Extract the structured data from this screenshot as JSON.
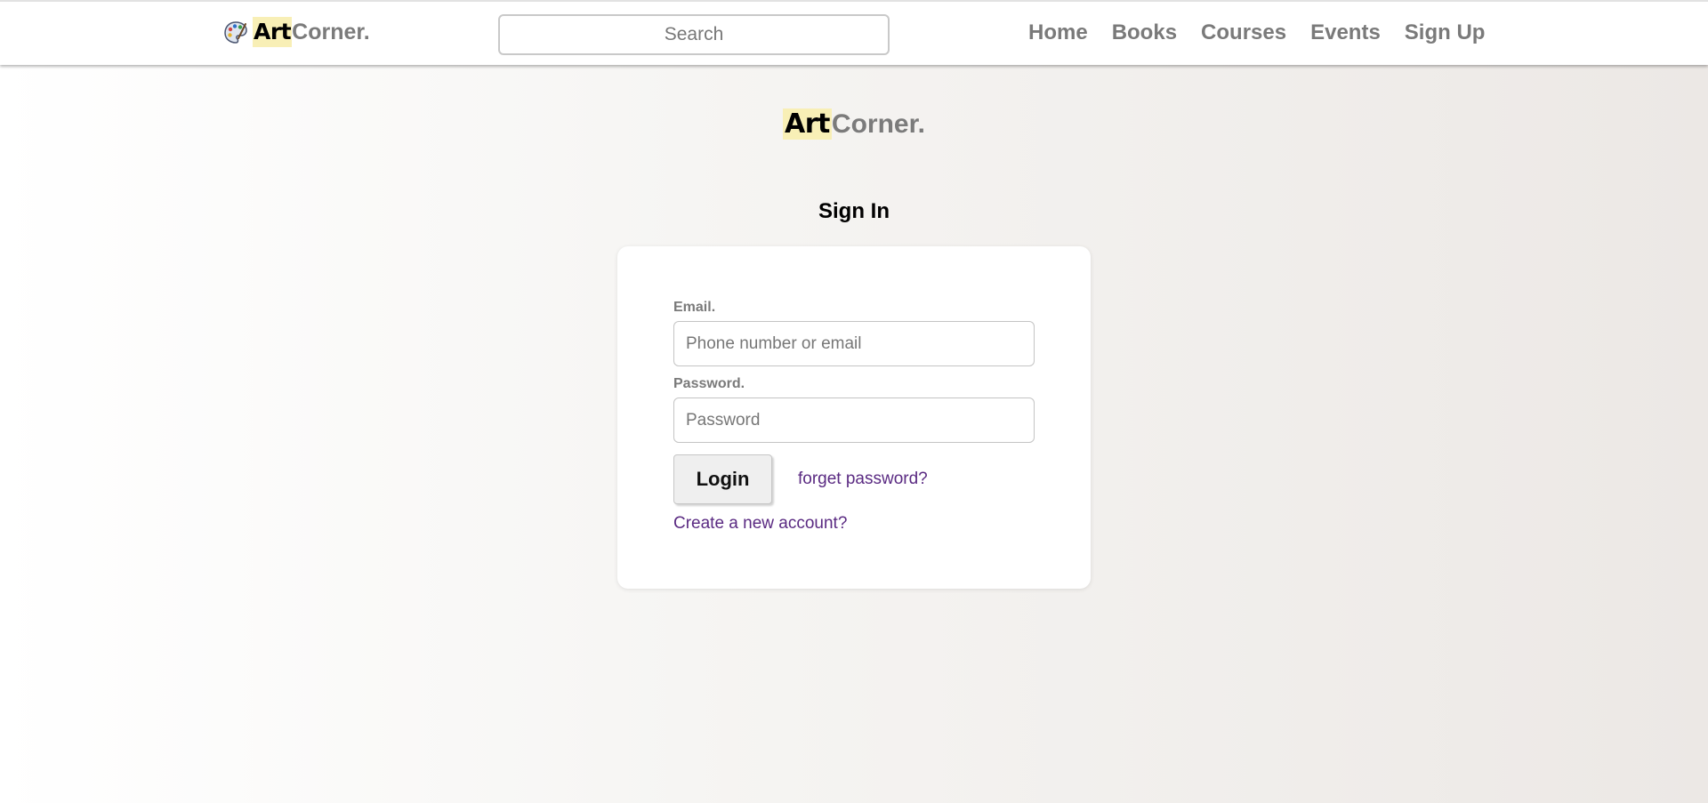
{
  "nav": {
    "logo": {
      "art": "Art",
      "corner": "Corner.",
      "icon": "palette-icon"
    },
    "search": {
      "placeholder": "Search",
      "value": ""
    },
    "links": [
      "Home",
      "Books",
      "Courses",
      "Events",
      "Sign Up"
    ]
  },
  "hero_logo": {
    "art": "Art",
    "corner": "Corner."
  },
  "page_title": "Sign In",
  "form": {
    "email": {
      "label": "Email.",
      "placeholder": "Phone number or email",
      "value": ""
    },
    "password": {
      "label": "Password.",
      "placeholder": "Password",
      "value": ""
    },
    "login_label": "Login",
    "forgot_link": "forget password?",
    "create_account_link": "Create a new account?"
  },
  "colors": {
    "logo_highlight": "#f8efb6",
    "nav_text": "#7a7a7a",
    "link": "#5a2a82",
    "card": "#ffffff"
  }
}
